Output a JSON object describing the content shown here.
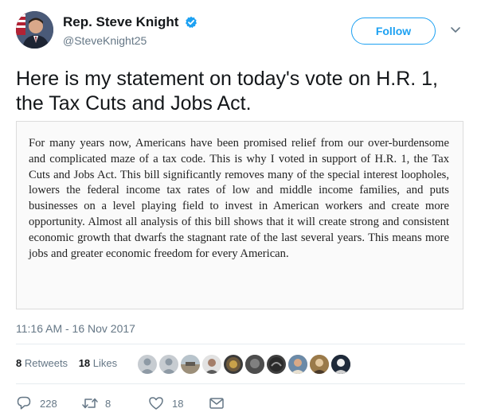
{
  "author": {
    "name": "Rep. Steve Knight",
    "handle": "@SteveKnight25",
    "verified": true
  },
  "follow_label": "Follow",
  "tweet_text": "Here is my statement on today's vote on H.R. 1, the Tax Cuts and Jobs Act.",
  "statement": "For many years now, Americans have been promised relief from our over-burdensome and complicated maze of a tax code. This is why I voted in support of H.R. 1, the Tax Cuts and Jobs Act. This bill significantly removes many of the special interest loopholes, lowers the federal income tax rates of low and middle income families, and puts businesses on a level playing field to invest in American workers and create more opportunity. Almost all analysis of this bill shows that it will create strong and consistent economic growth that dwarfs the stagnant rate of the last several years. This means more jobs and greater economic freedom for every American.",
  "timestamp": "11:16 AM - 16 Nov 2017",
  "stats": {
    "retweets_count": "8",
    "retweets_label": "Retweets",
    "likes_count": "18",
    "likes_label": "Likes"
  },
  "actions": {
    "reply_count": "228",
    "retweet_count": "8",
    "like_count": "18"
  },
  "colors": {
    "accent": "#1da1f2",
    "verified": "#1da1f2",
    "secondary_text": "#657786"
  },
  "icons": [
    "verified-badge-icon",
    "chevron-down-icon",
    "reply-icon",
    "retweet-icon",
    "heart-icon",
    "envelope-icon"
  ]
}
